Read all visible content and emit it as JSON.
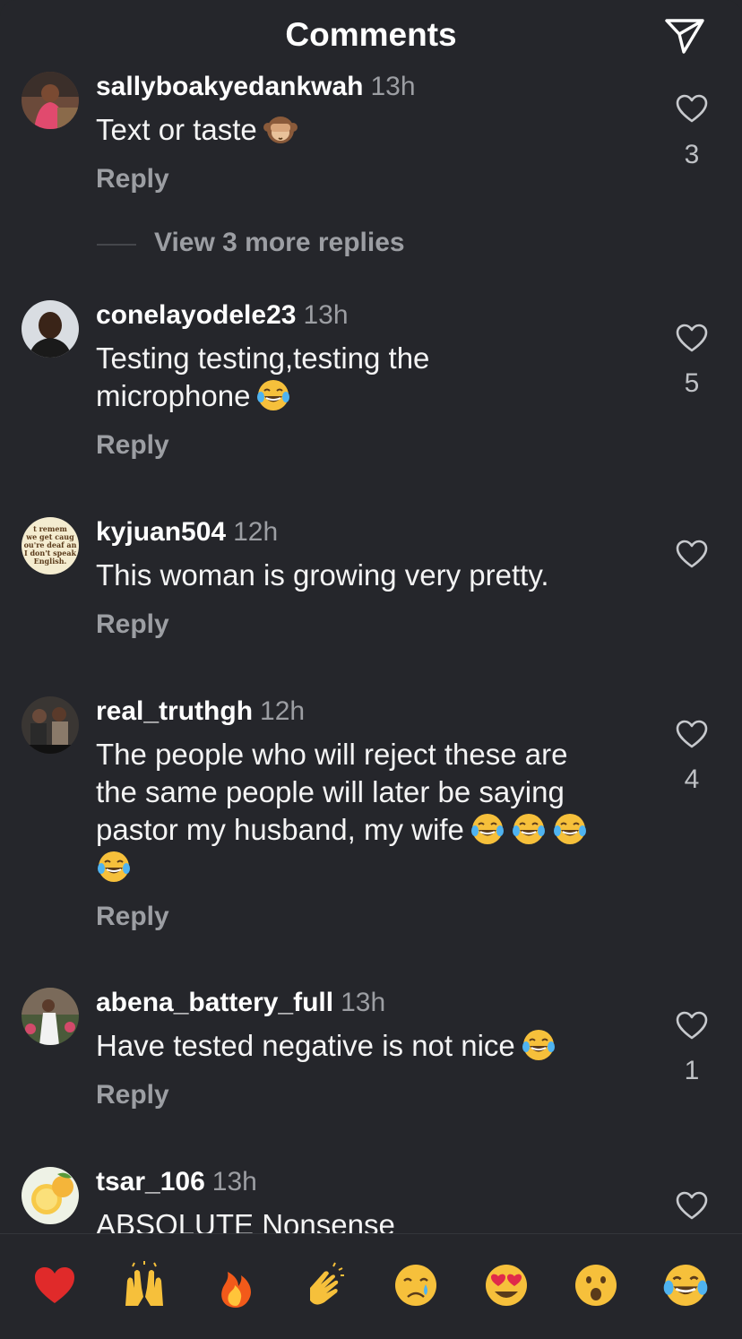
{
  "header": {
    "title": "Comments",
    "send_icon": "send-icon"
  },
  "comments": [
    {
      "username": "sallyboakyedankwah",
      "time": "13h",
      "text": "Text or taste",
      "emoji": [
        "see-no-evil-monkey"
      ],
      "reply": "Reply",
      "likes": "3",
      "view_more": "View 3 more replies"
    },
    {
      "username": "conelayodele23",
      "time": "13h",
      "text_lines": [
        "Testing testing,testing the",
        "microphone"
      ],
      "emoji": [
        "face-with-tears-of-joy"
      ],
      "reply": "Reply",
      "likes": "5"
    },
    {
      "username": "kyjuan504",
      "time": "12h",
      "text": "This woman is growing very pretty.",
      "reply": "Reply",
      "likes": "",
      "avatar_text": [
        "t remem",
        "we get caug",
        "ou're deaf an",
        "I don't speak",
        "English."
      ]
    },
    {
      "username": "real_truthgh",
      "time": "12h",
      "text_lines": [
        "The people who will reject these are",
        "the same people will later be saying",
        "pastor my husband, my wife"
      ],
      "emoji": [
        "face-with-tears-of-joy",
        "face-with-tears-of-joy",
        "face-with-tears-of-joy",
        "face-with-tears-of-joy"
      ],
      "reply": "Reply",
      "likes": "4"
    },
    {
      "username": "abena_battery_full",
      "time": "13h",
      "text": "Have tested negative is not nice",
      "emoji": [
        "face-with-tears-of-joy"
      ],
      "reply": "Reply",
      "likes": "1"
    },
    {
      "username": "tsar_106",
      "time": "13h",
      "text": "ABSOLUTE Nonsense",
      "likes": ""
    }
  ],
  "reactions": [
    {
      "name": "red-heart",
      "emoji": "❤️"
    },
    {
      "name": "raising-hands",
      "emoji": "🙌"
    },
    {
      "name": "fire",
      "emoji": "🔥"
    },
    {
      "name": "clapping-hands",
      "emoji": "👏"
    },
    {
      "name": "crying-face",
      "emoji": "😢"
    },
    {
      "name": "heart-eyes",
      "emoji": "😍"
    },
    {
      "name": "surprised-face",
      "emoji": "😮"
    },
    {
      "name": "face-with-tears-of-joy",
      "emoji": "😂"
    }
  ],
  "colors": {
    "background": "#25262b",
    "secondary_text": "#9c9ea3",
    "primary_text": "#f4f4f4"
  }
}
